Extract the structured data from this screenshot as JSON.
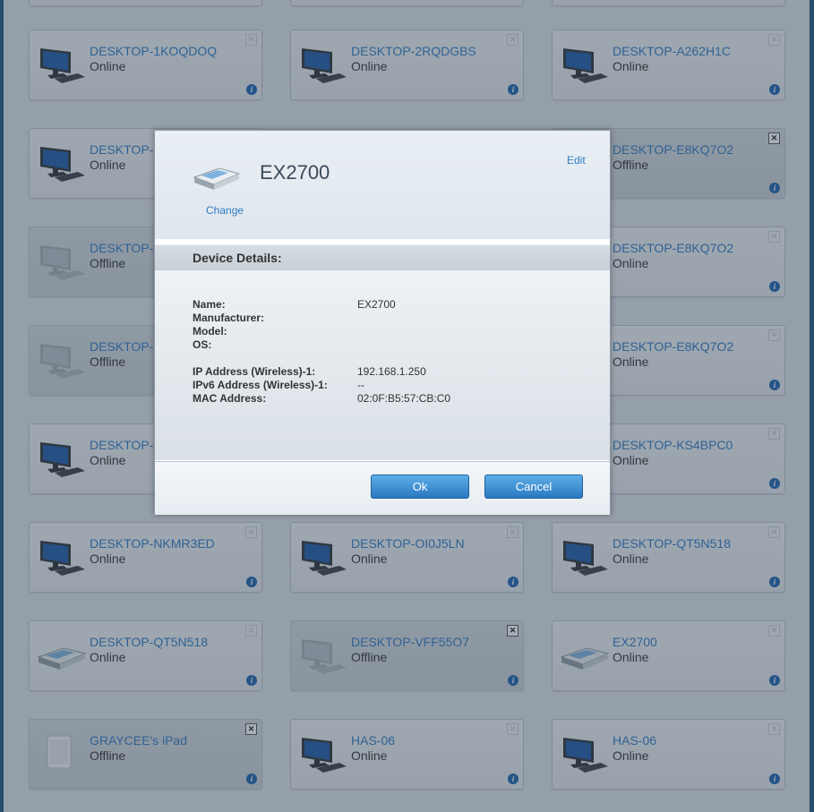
{
  "devices": [
    {
      "name": "DESKTOP-1KOQDOQ",
      "status": "Online",
      "icon": "computer-icon",
      "offline": false,
      "removable": false
    },
    {
      "name": "DESKTOP-2RQDGBS",
      "status": "Online",
      "icon": "computer-icon",
      "offline": false,
      "removable": false
    },
    {
      "name": "DESKTOP-A262H1C",
      "status": "Online",
      "icon": "computer-icon",
      "offline": false,
      "removable": false
    },
    {
      "name": "DESKTOP-",
      "status": "Online",
      "icon": "computer-icon",
      "offline": false,
      "removable": false
    },
    {
      "name": "",
      "status": "",
      "icon": "",
      "offline": false,
      "removable": false,
      "hidden": true
    },
    {
      "name": "DESKTOP-E8KQ7O2",
      "status": "Offline",
      "icon": "computer-icon",
      "offline": true,
      "removable": true
    },
    {
      "name": "DESKTOP-",
      "status": "Offline",
      "icon": "computer-icon",
      "offline": true,
      "removable": false
    },
    {
      "name": "",
      "status": "",
      "icon": "",
      "offline": false,
      "removable": false,
      "hidden": true
    },
    {
      "name": "DESKTOP-E8KQ7O2",
      "status": "Online",
      "icon": "computer-icon",
      "offline": false,
      "removable": false
    },
    {
      "name": "DESKTOP-",
      "status": "Offline",
      "icon": "computer-icon",
      "offline": true,
      "removable": false
    },
    {
      "name": "",
      "status": "",
      "icon": "",
      "offline": false,
      "removable": false,
      "hidden": true
    },
    {
      "name": "DESKTOP-E8KQ7O2",
      "status": "Online",
      "icon": "computer-icon",
      "offline": false,
      "removable": false
    },
    {
      "name": "DESKTOP-",
      "status": "Online",
      "icon": "computer-icon",
      "offline": false,
      "removable": false
    },
    {
      "name": "",
      "status": "",
      "icon": "",
      "offline": false,
      "removable": false,
      "hidden": true
    },
    {
      "name": "DESKTOP-KS4BPC0",
      "status": "Online",
      "icon": "computer-icon",
      "offline": false,
      "removable": false
    },
    {
      "name": "DESKTOP-NKMR3ED",
      "status": "Online",
      "icon": "computer-icon",
      "offline": false,
      "removable": false
    },
    {
      "name": "DESKTOP-OI0J5LN",
      "status": "Online",
      "icon": "computer-icon",
      "offline": false,
      "removable": false
    },
    {
      "name": "DESKTOP-QT5N518",
      "status": "Online",
      "icon": "computer-icon",
      "offline": false,
      "removable": false
    },
    {
      "name": "DESKTOP-QT5N518",
      "status": "Online",
      "icon": "network-device-icon",
      "offline": false,
      "removable": false
    },
    {
      "name": "DESKTOP-VFF55O7",
      "status": "Offline",
      "icon": "computer-icon",
      "offline": true,
      "removable": true
    },
    {
      "name": "EX2700",
      "status": "Online",
      "icon": "network-device-icon",
      "offline": false,
      "removable": false
    },
    {
      "name": "GRAYCEE's iPad",
      "status": "Offline",
      "icon": "tablet-icon",
      "offline": true,
      "removable": true
    },
    {
      "name": "HAS-06",
      "status": "Online",
      "icon": "computer-icon",
      "offline": false,
      "removable": false
    },
    {
      "name": "HAS-06",
      "status": "Online",
      "icon": "computer-icon",
      "offline": false,
      "removable": false
    }
  ],
  "modal": {
    "title": "EX2700",
    "edit_label": "Edit",
    "change_label": "Change",
    "section_title": "Device Details:",
    "details": [
      {
        "key": "Name:",
        "value": "EX2700"
      },
      {
        "key": "Manufacturer:",
        "value": ""
      },
      {
        "key": "Model:",
        "value": ""
      },
      {
        "key": "OS:",
        "value": ""
      },
      {
        "key": "IP Address (Wireless)-1:",
        "value": "192.168.1.250"
      },
      {
        "key": "IPv6 Address (Wireless)-1:",
        "value": "--"
      },
      {
        "key": "MAC Address:",
        "value": "02:0F:B5:57:CB:C0"
      }
    ],
    "ok_label": "Ok",
    "cancel_label": "Cancel"
  },
  "colors": {
    "link": "#2f7ac4",
    "button": "#2a78c1",
    "frame": "#1f5a86"
  }
}
